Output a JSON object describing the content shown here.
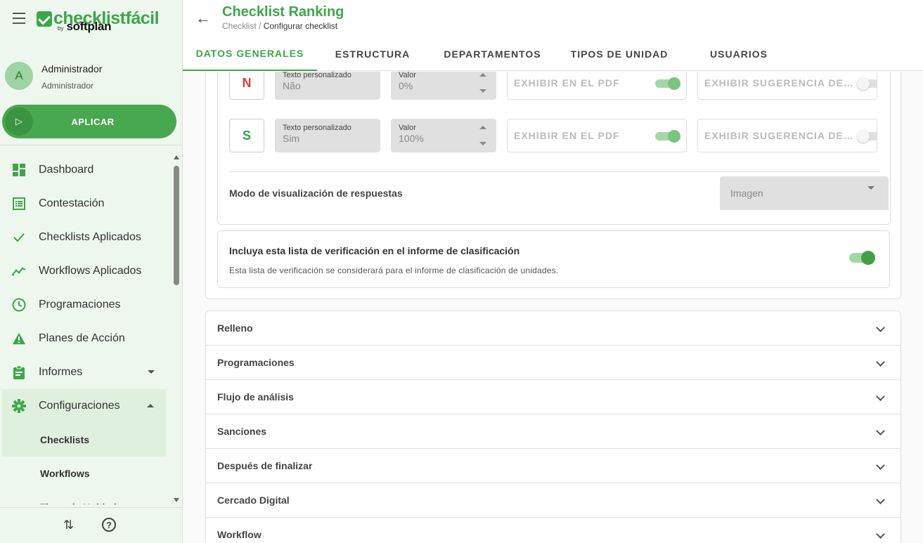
{
  "sidebar": {
    "logo_main": "checklistfácil",
    "logo_by": "by",
    "logo_brand": "softplan",
    "user": {
      "initial": "A",
      "name": "Administrador",
      "role": "Administrador"
    },
    "apply_label": "APLICAR",
    "nav": [
      {
        "label": "Dashboard",
        "icon": "dashboard-icon"
      },
      {
        "label": "Contestación",
        "icon": "list-icon"
      },
      {
        "label": "Checklists Aplicados",
        "icon": "check-icon"
      },
      {
        "label": "Workflows Aplicados",
        "icon": "trend-icon"
      },
      {
        "label": "Programaciones",
        "icon": "clock-icon"
      },
      {
        "label": "Planes de Acción",
        "icon": "warning-icon"
      },
      {
        "label": "Informes",
        "icon": "clipboard-icon"
      },
      {
        "label": "Configuraciones",
        "icon": "gear-icon"
      }
    ],
    "subnav": [
      "Checklists",
      "Workflows",
      "Tipos de Unidad"
    ],
    "accent": "#3da64a"
  },
  "header": {
    "title": "Checklist Ranking",
    "breadcrumb_root": "Checklist",
    "breadcrumb_sep": "/",
    "breadcrumb_current": "Configurar checklist",
    "tabs": [
      "DATOS GENERALES",
      "ESTRUCTURA",
      "DEPARTAMENTOS",
      "TIPOS DE UNIDAD",
      "USUARIOS"
    ]
  },
  "answers": [
    {
      "letter": "N",
      "letter_color": "#e53935",
      "text_label": "Texto personalizado",
      "text_value": "Não",
      "value_label": "Valor",
      "value": "0%",
      "pdf_label": "EXHIBIR EN EL PDF",
      "pdf_on": true,
      "suggest_label": "EXHIBIR SUGERENCIA DE…",
      "suggest_on": false
    },
    {
      "letter": "S",
      "letter_color": "#2e9e4f",
      "text_label": "Texto personalizado",
      "text_value": "Sim",
      "value_label": "Valor",
      "value": "100%",
      "pdf_label": "EXHIBIR EN EL PDF",
      "pdf_on": true,
      "suggest_label": "EXHIBIR SUGERENCIA DE…",
      "suggest_on": false
    }
  ],
  "display_mode": {
    "label": "Modo de visualización de respuestas",
    "value": "Imagen"
  },
  "ranking": {
    "title": "Incluya esta lista de verificación en el informe de clasificación",
    "description": "Esta lista de verificación se considerará para el informe de clasificación de unidades.",
    "enabled": true
  },
  "sections": [
    "Relleno",
    "Programaciones",
    "Flujo de análisis",
    "Sanciones",
    "Después de finalizar",
    "Cercado Digital",
    "Workflow"
  ]
}
